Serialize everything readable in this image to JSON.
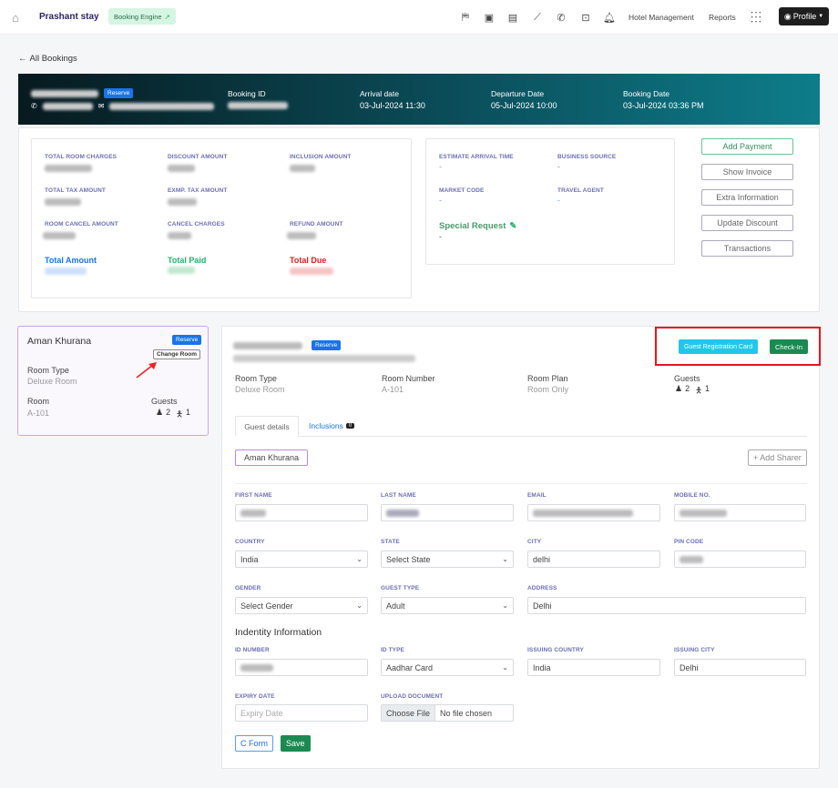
{
  "header": {
    "brand": "Prashant stay",
    "booking_engine": "Booking Engine",
    "hotel_management": "Hotel Management",
    "reports": "Reports",
    "profile": "Profile",
    "icons": [
      "bed-icon",
      "calendar-icon",
      "calendar-grid-icon",
      "chart-icon",
      "phone-icon",
      "cash-icon",
      "bell-icon"
    ]
  },
  "back_link": "All Bookings",
  "banner": {
    "status": "Reserve",
    "booking_id_label": "Booking ID",
    "arrival_label": "Arrival date",
    "arrival": "03-Jul-2024 11:30",
    "departure_label": "Departure Date",
    "departure": "05-Jul-2024 10:00",
    "booking_date_label": "Booking Date",
    "booking_date": "03-Jul-2024 03:36 PM"
  },
  "summary": {
    "total_room_charges": "TOTAL ROOM CHARGES",
    "discount_amount": "DISCOUNT AMOUNT",
    "inclusion_amount": "INCLUSION AMOUNT",
    "total_tax_amount": "TOTAL TAX AMOUNT",
    "exmp_tax_amount": "EXMP. TAX AMOUNT",
    "room_cancel_amount": "ROOM CANCEL AMOUNT",
    "cancel_charges": "CANCEL CHARGES",
    "refund_amount": "REFUND AMOUNT",
    "total_amount": "Total Amount",
    "total_paid": "Total Paid",
    "total_due": "Total Due"
  },
  "info": {
    "eta_label": "ESTIMATE ARRIVAL TIME",
    "eta": "-",
    "business_source_label": "BUSINESS SOURCE",
    "business_source": "-",
    "market_code_label": "MARKET CODE",
    "market_code": "-",
    "travel_agent_label": "TRAVEL AGENT",
    "travel_agent": "-",
    "special_request_label": "Special Request",
    "special_request": "-"
  },
  "actions": [
    "Add Payment",
    "Show Invoice",
    "Extra Information",
    "Update Discount",
    "Transactions"
  ],
  "room_card": {
    "guest": "Aman Khurana",
    "status": "Reserve",
    "change_room": "Change Room",
    "room_type_label": "Room Type",
    "room_type": "Deluxe Room",
    "room_label": "Room",
    "room": "A-101",
    "guests_label": "Guests",
    "adults": "2",
    "children": "1"
  },
  "detail": {
    "status": "Reserve",
    "guest_registration_card": "Guest Registration Card",
    "check_in": "Check-In",
    "room_type_label": "Room Type",
    "room_type": "Deluxe Room",
    "room_number_label": "Room Number",
    "room_number": "A-101",
    "room_plan_label": "Room Plan",
    "room_plan": "Room Only",
    "guests_label": "Guests",
    "adults": "2",
    "children": "1",
    "tabs": {
      "guest_details": "Guest details",
      "inclusions": "Inclusions",
      "inclusions_count": "0"
    },
    "guest_chip": "Aman Khurana",
    "add_sharer": "+ Add Sharer"
  },
  "form": {
    "first_name_label": "FIRST NAME",
    "last_name_label": "LAST NAME",
    "email_label": "EMAIL",
    "mobile_label": "MOBILE NO.",
    "country_label": "COUNTRY",
    "country": "India",
    "state_label": "STATE",
    "state": "Select State",
    "city_label": "CITY",
    "city": "delhi",
    "pin_label": "PIN CODE",
    "gender_label": "GENDER",
    "gender": "Select Gender",
    "guest_type_label": "GUEST TYPE",
    "guest_type": "Adult",
    "address_label": "ADDRESS",
    "address": "Delhi",
    "identity_heading": "Indentity Information",
    "id_number_label": "ID NUMBER",
    "id_type_label": "ID TYPE",
    "id_type": "Aadhar Card",
    "issuing_country_label": "ISSUING COUNTRY",
    "issuing_country": "India",
    "issuing_city_label": "ISSUING CITY",
    "issuing_city": "Delhi",
    "expiry_label": "EXPIRY DATE",
    "expiry_placeholder": "Expiry Date",
    "upload_label": "UPLOAD DOCUMENT",
    "choose_file": "Choose File",
    "no_file": "No file chosen",
    "c_form": "C Form",
    "save": "Save"
  }
}
